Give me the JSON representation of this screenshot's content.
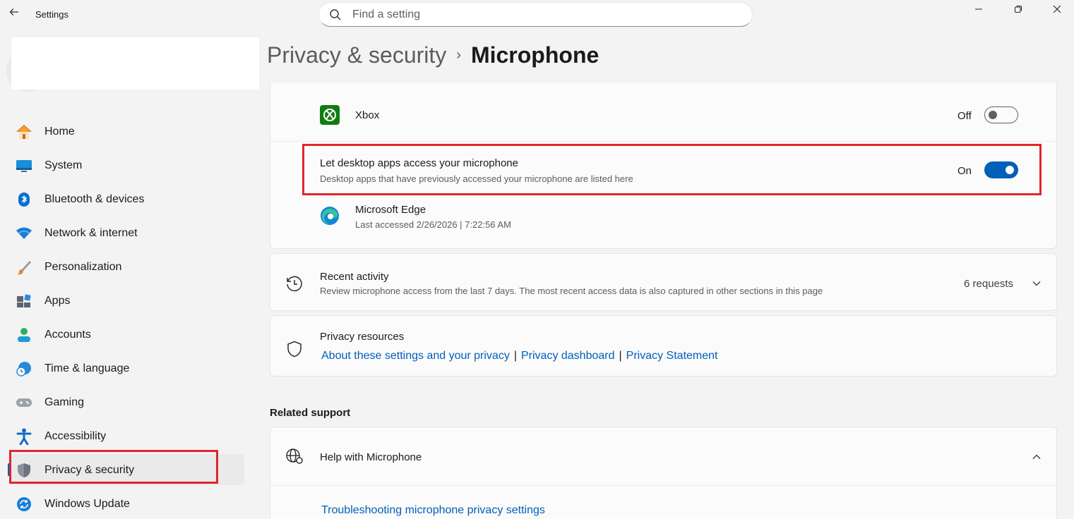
{
  "window": {
    "title": "Settings",
    "controls": {
      "minimize": "minimize-icon",
      "maximize": "restore-icon",
      "close": "close-icon"
    }
  },
  "search": {
    "placeholder": "Find a setting"
  },
  "sidebar": {
    "items": [
      {
        "label": "Home",
        "icon": "home-icon"
      },
      {
        "label": "System",
        "icon": "system-icon"
      },
      {
        "label": "Bluetooth & devices",
        "icon": "bluetooth-icon"
      },
      {
        "label": "Network & internet",
        "icon": "wifi-icon"
      },
      {
        "label": "Personalization",
        "icon": "brush-icon"
      },
      {
        "label": "Apps",
        "icon": "apps-icon"
      },
      {
        "label": "Accounts",
        "icon": "account-icon"
      },
      {
        "label": "Time & language",
        "icon": "clock-globe-icon"
      },
      {
        "label": "Gaming",
        "icon": "gamepad-icon"
      },
      {
        "label": "Accessibility",
        "icon": "accessibility-icon"
      },
      {
        "label": "Privacy & security",
        "icon": "shield-icon",
        "selected": true
      },
      {
        "label": "Windows Update",
        "icon": "update-icon"
      }
    ]
  },
  "breadcrumb": {
    "parent": "Privacy & security",
    "separator": "›",
    "current": "Microphone"
  },
  "apps": {
    "xbox": {
      "name": "Xbox",
      "state_label": "Off",
      "enabled": false
    },
    "desktop": {
      "title": "Let desktop apps access your microphone",
      "description": "Desktop apps that have previously accessed your microphone are listed here",
      "state_label": "On",
      "enabled": true
    },
    "edge": {
      "name": "Microsoft Edge",
      "last_accessed": "Last accessed 2/26/2026  |  7:22:56 AM"
    }
  },
  "recent": {
    "title": "Recent activity",
    "description": "Review microphone access from the last 7 days. The most recent access data is also captured in other sections in this page",
    "count": "6 requests"
  },
  "privacy_resources": {
    "title": "Privacy resources",
    "links": [
      "About these settings and your privacy",
      "Privacy dashboard",
      "Privacy Statement"
    ],
    "separator": "|"
  },
  "related_support": {
    "heading": "Related support",
    "help_title": "Help with Microphone",
    "help_link": "Troubleshooting microphone privacy settings"
  },
  "colors": {
    "accent": "#005fb8",
    "highlight_box": "#e0262c",
    "xbox_green": "#107c10"
  }
}
